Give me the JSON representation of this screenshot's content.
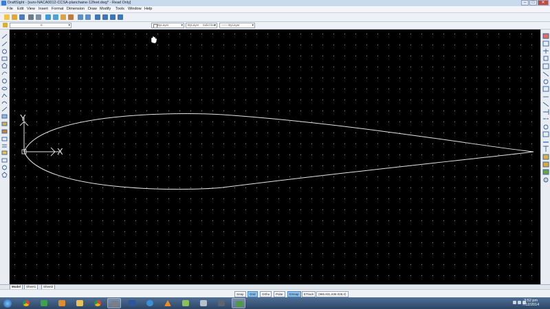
{
  "window": {
    "title": "DraftSight - [surv-NACA0012-CCSA-planchaine-12feet.dwg* - Read Only]",
    "controls": {
      "minimize": "–",
      "maximize": "□",
      "close": "✕"
    }
  },
  "menu": [
    "File",
    "Edit",
    "View",
    "Insert",
    "Format",
    "Dimension",
    "Draw",
    "Modify",
    "Tools",
    "Window",
    "Help"
  ],
  "toolbar2": {
    "layer_value": "0",
    "color_value": "ByLayer",
    "linestyle_value": "ByLayer",
    "linestyle_label": "Solid line",
    "lineweight_value": "ByLayer"
  },
  "tabs": [
    "Model",
    "Sheet1",
    "Sheet2"
  ],
  "status": {
    "buttons": [
      "Snap",
      "Grid",
      "Ortho",
      "Polar",
      "ESnap",
      "ETrack"
    ],
    "on": [
      "Grid",
      "ESnap"
    ],
    "coordinates": "(985.831,838.028,0)"
  },
  "axis": {
    "x_label": "X",
    "y_label": "Y"
  },
  "clock": {
    "time": "3:52 pm",
    "date": "7/12/2014"
  },
  "taskbar_apps": [
    "start-orb",
    "chrome-icon",
    "media-center-icon",
    "media-player-icon",
    "file-explorer-icon",
    "chrome-icon",
    "draftsight-icon",
    "word-icon",
    "ie-icon",
    "vlc-icon",
    "paint-icon",
    "tool-icon",
    "computer-icon",
    "draftsight-icon-2"
  ],
  "colors": {
    "canvas": "#000000",
    "grid": "#8a8a8a",
    "curve": "#e6e6e6",
    "accent": "#8ec2ec"
  }
}
